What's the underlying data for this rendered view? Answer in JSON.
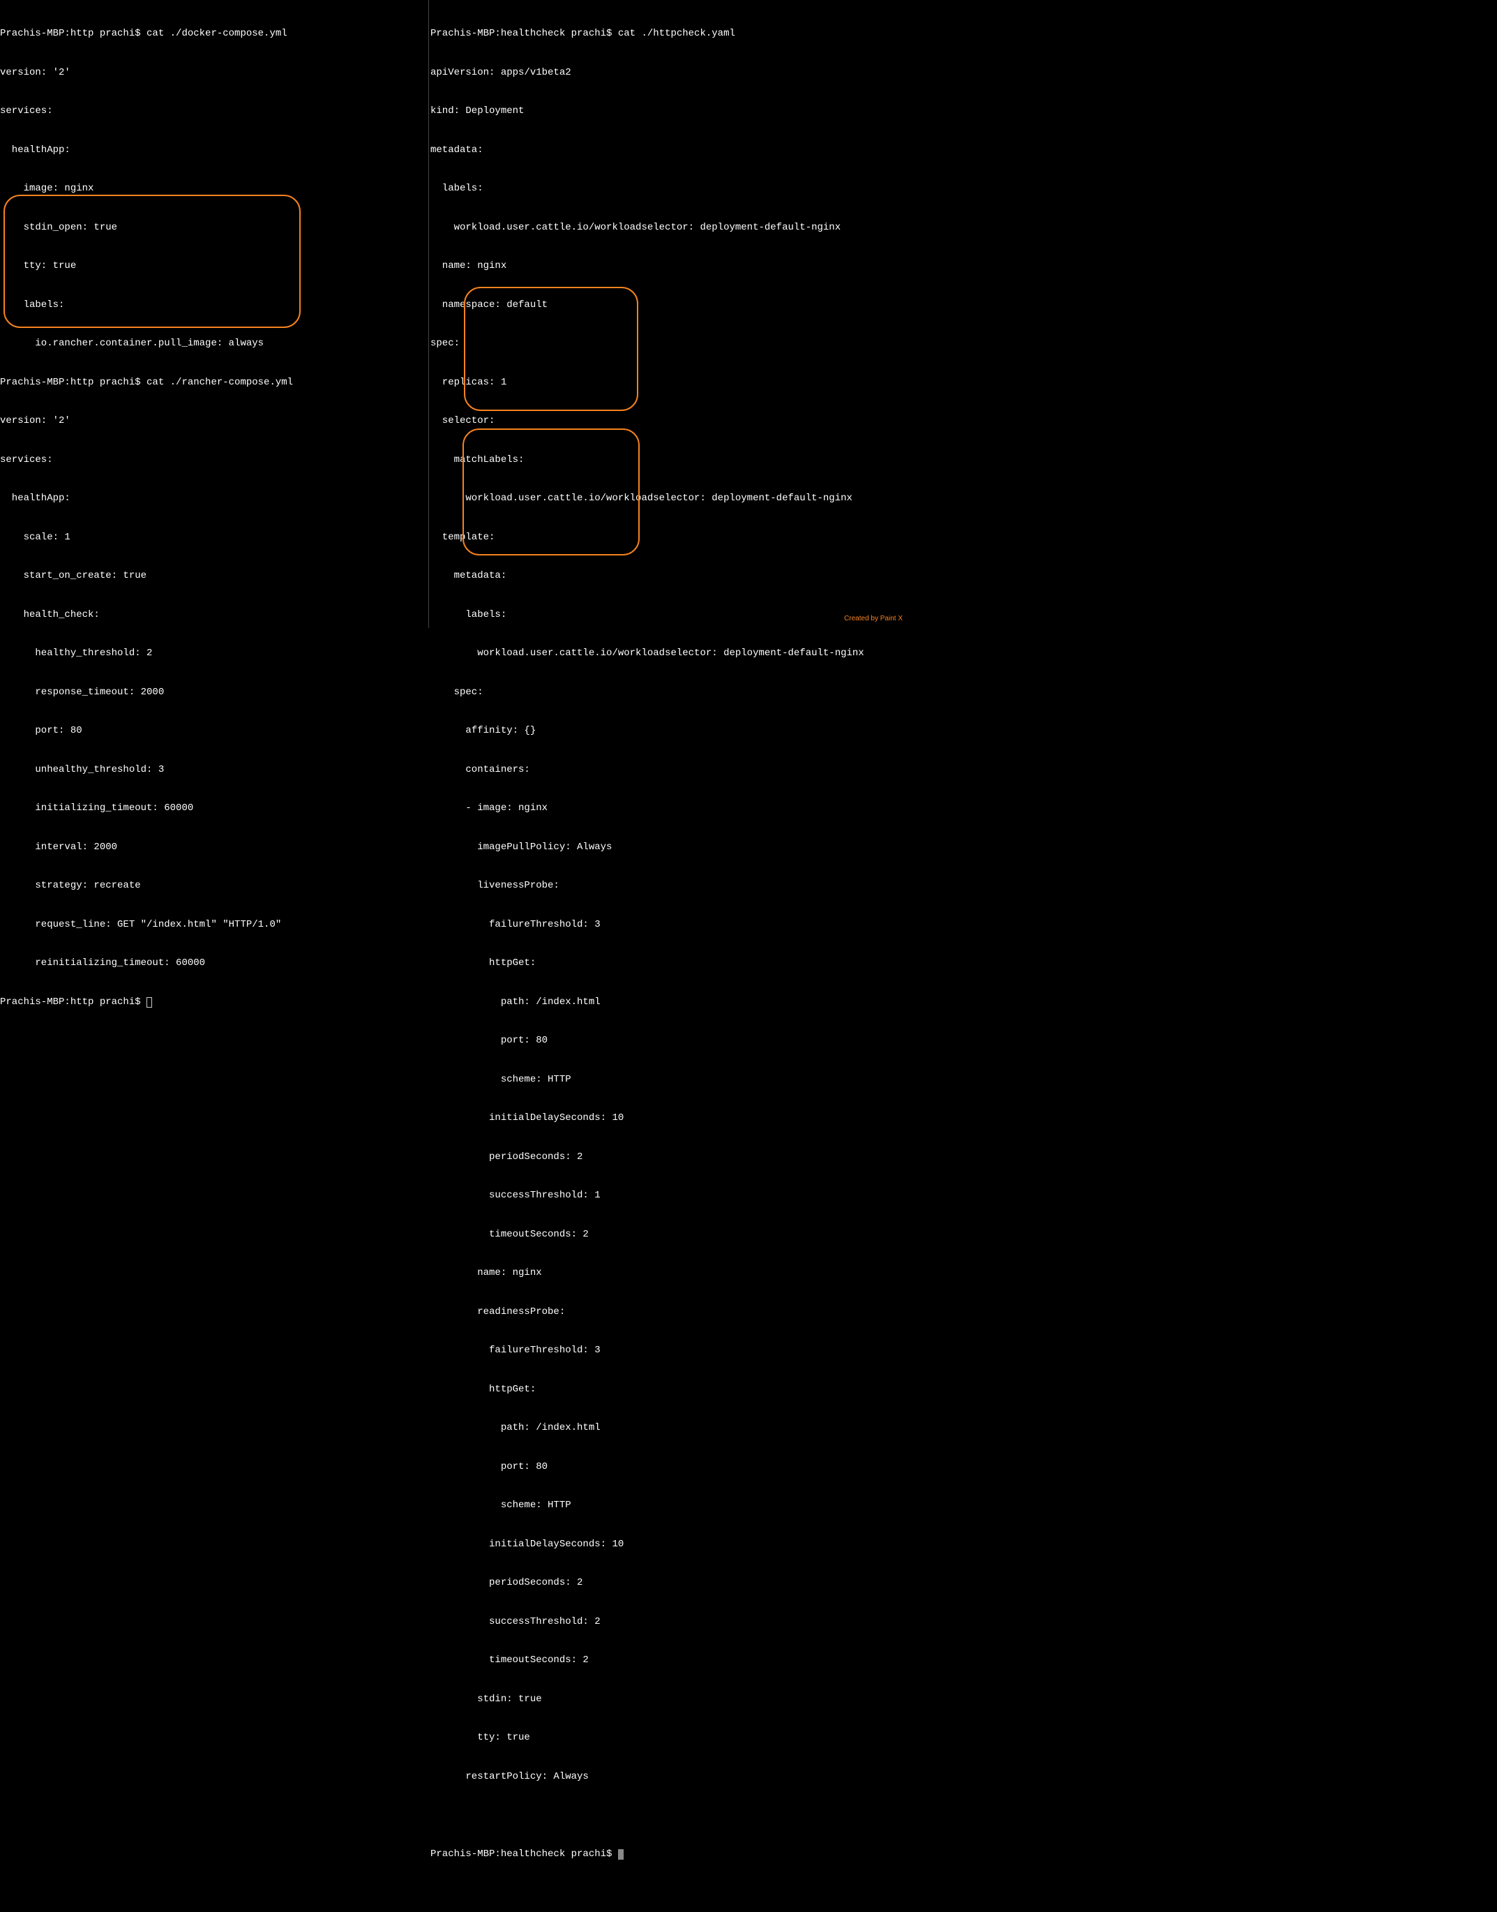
{
  "left": {
    "prompt1": "Prachis-MBP:http prachi$ cat ./docker-compose.yml",
    "l1": "version: '2'",
    "l2": "services:",
    "l3": "  healthApp:",
    "l4": "    image: nginx",
    "l5": "    stdin_open: true",
    "l6": "    tty: true",
    "l7": "    labels:",
    "l8": "      io.rancher.container.pull_image: always",
    "prompt2": "Prachis-MBP:http prachi$ cat ./rancher-compose.yml",
    "l9": "version: '2'",
    "l10": "services:",
    "l11": "  healthApp:",
    "l12": "    scale: 1",
    "l13": "    start_on_create: true",
    "l14": "    health_check:",
    "l15": "      healthy_threshold: 2",
    "l16": "      response_timeout: 2000",
    "l17": "      port: 80",
    "l18": "      unhealthy_threshold: 3",
    "l19": "      initializing_timeout: 60000",
    "l20": "      interval: 2000",
    "l21": "      strategy: recreate",
    "l22": "      request_line: GET \"/index.html\" \"HTTP/1.0\"",
    "l23": "      reinitializing_timeout: 60000",
    "prompt3": "Prachis-MBP:http prachi$ "
  },
  "right": {
    "prompt1": "Prachis-MBP:healthcheck prachi$ cat ./httpcheck.yaml",
    "r1": "apiVersion: apps/v1beta2",
    "r2": "kind: Deployment",
    "r3": "metadata:",
    "r4": "  labels:",
    "r5": "    workload.user.cattle.io/workloadselector: deployment-default-nginx",
    "r6": "  name: nginx",
    "r7": "  namespace: default",
    "r8": "spec:",
    "r9": "  replicas: 1",
    "r10": "  selector:",
    "r11": "    matchLabels:",
    "r12": "      workload.user.cattle.io/workloadselector: deployment-default-nginx",
    "r13": "  template:",
    "r14": "    metadata:",
    "r15": "      labels:",
    "r16": "        workload.user.cattle.io/workloadselector: deployment-default-nginx",
    "r17": "    spec:",
    "r18": "      affinity: {}",
    "r19": "      containers:",
    "r20": "      - image: nginx",
    "r21": "        imagePullPolicy: Always",
    "r22": "        livenessProbe:",
    "r23": "          failureThreshold: 3",
    "r24": "          httpGet:",
    "r25": "            path: /index.html",
    "r26": "            port: 80",
    "r27": "            scheme: HTTP",
    "r28": "          initialDelaySeconds: 10",
    "r29": "          periodSeconds: 2",
    "r30": "          successThreshold: 1",
    "r31": "          timeoutSeconds: 2",
    "r32": "        name: nginx",
    "r33": "        readinessProbe:",
    "r34": "          failureThreshold: 3",
    "r35": "          httpGet:",
    "r36": "            path: /index.html",
    "r37": "            port: 80",
    "r38": "            scheme: HTTP",
    "r39": "          initialDelaySeconds: 10",
    "r40": "          periodSeconds: 2",
    "r41": "          successThreshold: 2",
    "r42": "          timeoutSeconds: 2",
    "r43": "        stdin: true",
    "r44": "        tty: true",
    "r45": "      restartPolicy: Always",
    "blank": "",
    "prompt2": "Prachis-MBP:healthcheck prachi$ "
  },
  "watermark": "Created by Paint X"
}
